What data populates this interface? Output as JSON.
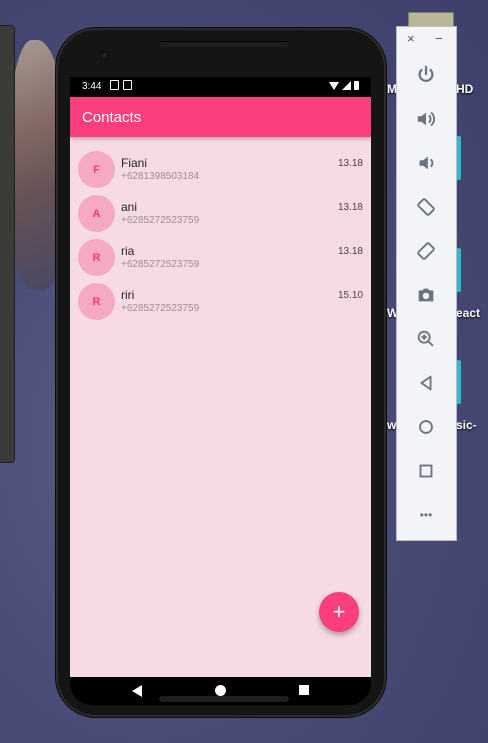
{
  "desktop": {
    "labels": [
      "HD",
      "eact",
      "sic-"
    ],
    "label_prefixes": [
      "M",
      "W",
      "w"
    ]
  },
  "status_bar": {
    "time": "3:44"
  },
  "app": {
    "title": "Contacts",
    "accent_color": "#fb3f7e",
    "background_color": "#f7dbe4",
    "avatar_color": "#f6a9c2"
  },
  "contacts": [
    {
      "initial": "F",
      "name": "Fiani",
      "phone": "+6281398503184",
      "time": "13.18"
    },
    {
      "initial": "A",
      "name": "ani",
      "phone": "+6285272523759",
      "time": "13.18"
    },
    {
      "initial": "R",
      "name": "ria",
      "phone": "+6285272523759",
      "time": "13.18"
    },
    {
      "initial": "R",
      "name": "riri",
      "phone": "+6285272523759",
      "time": "15.10"
    }
  ],
  "fab": {
    "label": "+",
    "icon": "add-icon"
  },
  "nav": {
    "back_icon": "back-icon",
    "home_icon": "home-icon",
    "recents_icon": "recents-icon"
  },
  "emulator_toolbar": {
    "close_label": "×",
    "minimize_label": "−",
    "buttons": [
      "power-icon",
      "volume-up-icon",
      "volume-down-icon",
      "rotate-left-icon",
      "rotate-right-icon",
      "camera-icon",
      "zoom-icon",
      "back-icon",
      "home-icon",
      "overview-icon",
      "more-icon"
    ],
    "more_label": "•••"
  }
}
